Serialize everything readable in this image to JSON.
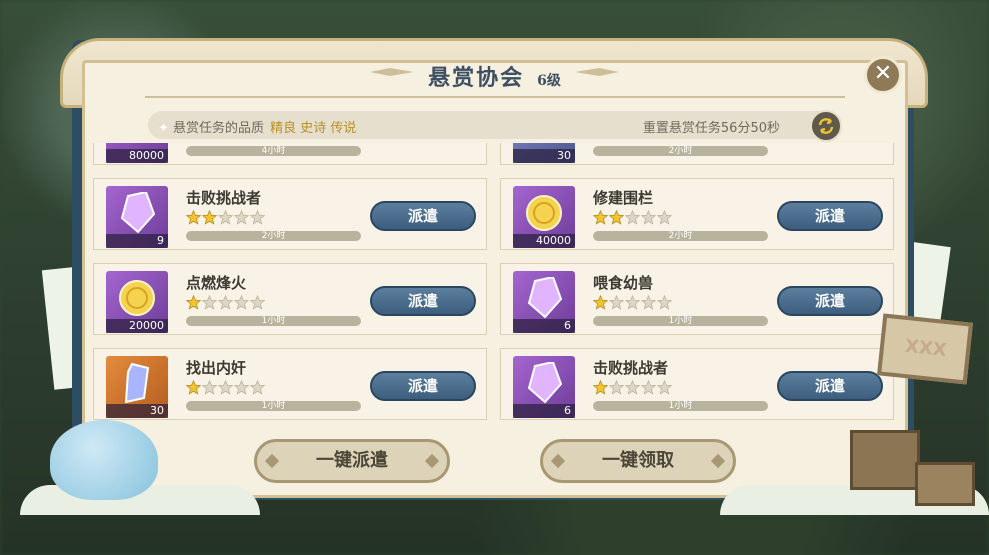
{
  "header": {
    "title": "悬赏协会",
    "level": "6级"
  },
  "info": {
    "quality_label": "悬赏任务的品质",
    "quality_values": "精良 史诗 传说",
    "reset_text": "重置悬赏任务56分50秒"
  },
  "partial_top": [
    {
      "count": "80000",
      "time": "4小时"
    },
    {
      "count": "30",
      "time": "2小时"
    }
  ],
  "tasks": [
    {
      "name": "击败挑战者",
      "stars": 2,
      "count": "9",
      "time": "2小时",
      "action": "派遣",
      "icon": "purple-crystal-icon"
    },
    {
      "name": "修建围栏",
      "stars": 2,
      "count": "40000",
      "time": "2小时",
      "action": "派遣",
      "icon": "gold-coin-icon"
    },
    {
      "name": "点燃烽火",
      "stars": 1,
      "count": "20000",
      "time": "1小时",
      "action": "派遣",
      "icon": "gold-coin-icon"
    },
    {
      "name": "喂食幼兽",
      "stars": 1,
      "count": "6",
      "time": "1小时",
      "action": "派遣",
      "icon": "purple-crystal-icon"
    },
    {
      "name": "找出内奸",
      "stars": 1,
      "count": "30",
      "time": "1小时",
      "action": "派遣",
      "icon": "blue-shard-icon"
    },
    {
      "name": "击败挑战者",
      "stars": 1,
      "count": "6",
      "time": "1小时",
      "action": "派遣",
      "icon": "purple-crystal-icon"
    }
  ],
  "footer": {
    "dispatch_all": "一键派遣",
    "claim_all": "一键领取"
  },
  "close_icon": "close-icon",
  "sign_text": "XXX",
  "colors": {
    "accent": "#3d5e7e",
    "star": "#f2c530",
    "quality": "#b89224"
  }
}
